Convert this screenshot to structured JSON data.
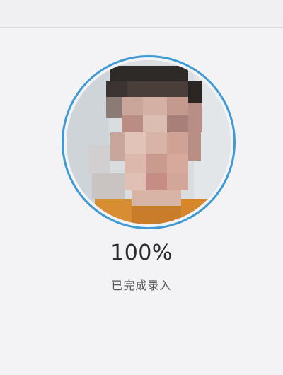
{
  "progress": {
    "percent_text": "100%",
    "status_text": "已完成录入",
    "value": 1.0
  },
  "colors": {
    "ring": "#3d9ad4",
    "background": "#f3f3f5"
  },
  "icons": {
    "avatar": "pixelated-face-photo"
  }
}
